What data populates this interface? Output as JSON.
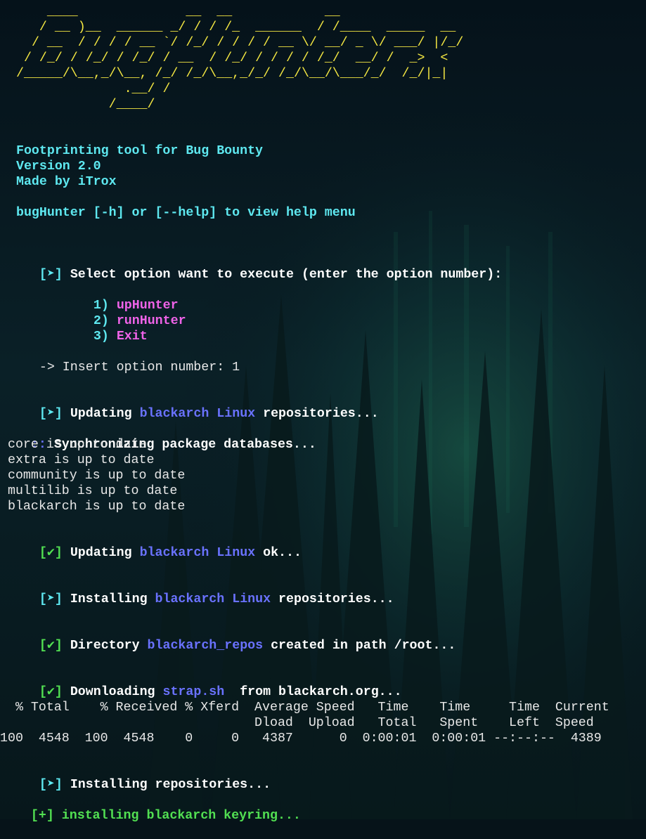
{
  "banner": {
    "lines": [
      "    ____              __  __            __",
      "   / __ )__  ______ _/ / / /_  ______  / /____  _____  __",
      "  / __  / / / / __ `/ /_/ / / / / __ \\/ __/ _ \\/ ___/ |/_/",
      " / /_/ / /_/ / /_/ / __  / /_/ / / / / /_/  __/ /  _>  <",
      "/_____/\\__,_/\\__, /_/ /_/\\__,_/_/ /_/\\__/\\___/_/  /_/|_|",
      "            /____/"
    ],
    "line_b": "              .__/ /"
  },
  "intro": {
    "l1": " Footprinting tool for Bug Bounty",
    "l2": " Version 2.0",
    "l3": " Made by iTrox",
    "l4": " bugHunter [-h] or [--help] to view help menu"
  },
  "menu": {
    "tag": "[➤]",
    "prompt": "Select option want to execute (enter the option number):",
    "options": [
      {
        "num": "1)",
        "label": "upHunter"
      },
      {
        "num": "2)",
        "label": "runHunter"
      },
      {
        "num": "3)",
        "label": "Exit"
      }
    ],
    "input_prompt": "-> Insert option number: ",
    "input_value": "1"
  },
  "log": {
    "updating_tag": "[➤]",
    "updating_a": "Updating ",
    "updating_b": "blackarch Linux",
    "updating_c": " repositories...",
    "sync_prefix": "::",
    "sync_text": " Synchronizing package databases...",
    "repos": [
      " core is up to date",
      " extra is up to date",
      " community is up to date",
      " multilib is up to date",
      " blackarch is up to date"
    ],
    "ok_tag": "[✔]",
    "ok_a": "Updating ",
    "ok_b": "blackarch Linux",
    "ok_c": " ok...",
    "install_tag": "[➤]",
    "install_a": "Installing ",
    "install_b": "blackarch Linux",
    "install_c": " repositories...",
    "dir_tag": "[✔]",
    "dir_a": "Directory ",
    "dir_b": "blackarch_repos",
    "dir_c": " created in path /root...",
    "dl_tag": "[✔]",
    "dl_a": "Downloading ",
    "dl_b": "strap.sh",
    "dl_c": "  from blackarch.org...",
    "curl_h1": "  % Total    % Received % Xferd  Average Speed   Time    Time     Time  Current",
    "curl_h2": "                                 Dload  Upload   Total   Spent    Left  Speed",
    "curl_row": "100  4548  100  4548    0     0   4387      0  0:00:01  0:00:01 --:--:--  4389",
    "repo_tag": "[➤]",
    "repo_text": "Installing repositories...",
    "keyring_tag": "[+]",
    "keyring_text": " installing blackarch keyring..."
  },
  "colors": {
    "banner": "#f4e742",
    "cyan": "#5ee8f0",
    "magenta": "#ef63e8",
    "blue": "#6a72ff",
    "green": "#52e052"
  }
}
